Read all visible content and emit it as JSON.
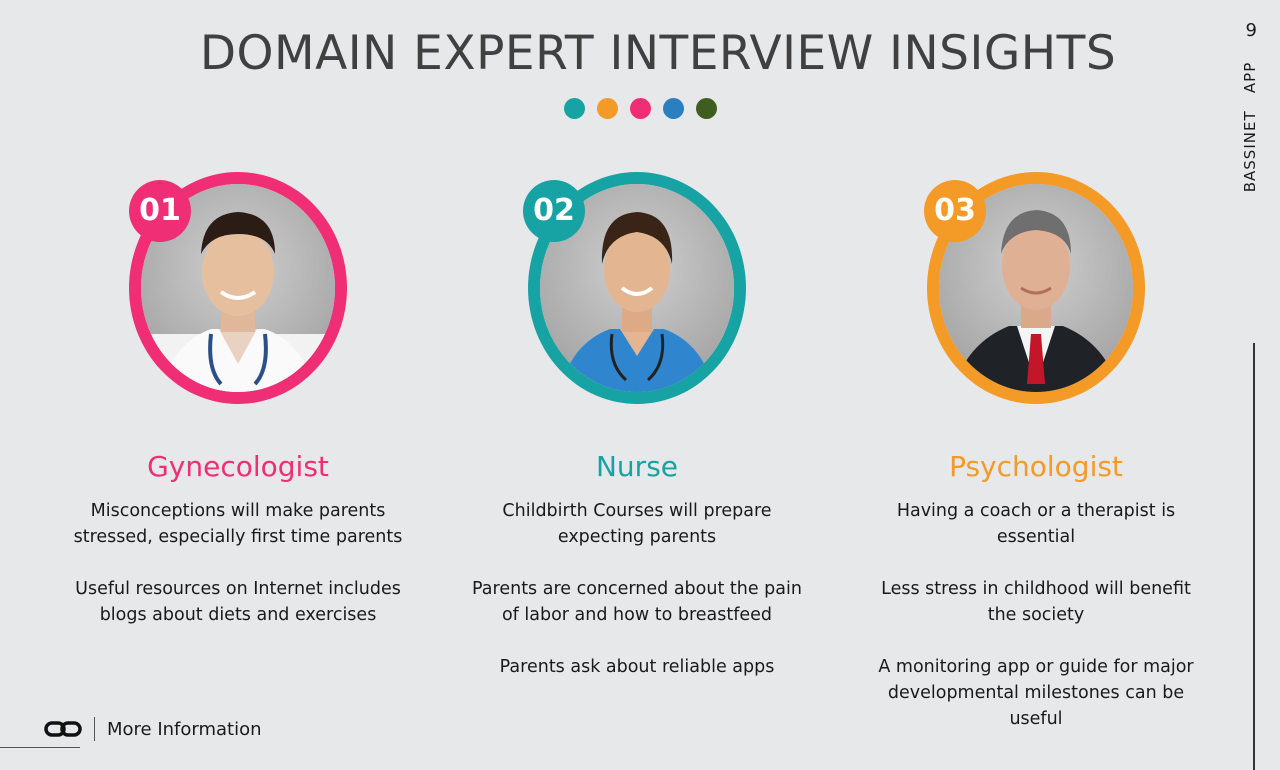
{
  "slide": {
    "title": "DOMAIN EXPERT INTERVIEW INSIGHTS",
    "page_number": "9",
    "side_label": "BASSINET   APP",
    "dot_colors": [
      "#17a3a4",
      "#f39a27",
      "#ef2e76",
      "#2a7fc1",
      "#3f5d1e"
    ]
  },
  "experts": [
    {
      "number": "01",
      "role": "Gynecologist",
      "accent": "#ef2e76",
      "icon": "doctor-portrait-icon",
      "points": [
        "Misconceptions will make parents stressed, especially first time parents",
        "Useful resources on Internet includes blogs about diets and exercises"
      ]
    },
    {
      "number": "02",
      "role": "Nurse",
      "accent": "#17a3a4",
      "icon": "nurse-portrait-icon",
      "points": [
        "Childbirth Courses will prepare expecting parents",
        "Parents are concerned about the pain of labor and how to breastfeed",
        "Parents ask about reliable apps"
      ]
    },
    {
      "number": "03",
      "role": "Psychologist",
      "accent": "#f39a27",
      "icon": "psychologist-portrait-icon",
      "points": [
        "Having a coach or a therapist is essential",
        "Less stress in childhood will benefit the society",
        "A monitoring app or guide for major developmental milestones can be useful"
      ]
    }
  ],
  "footer": {
    "link_label": "More Information",
    "link_icon": "chain-link-icon"
  }
}
